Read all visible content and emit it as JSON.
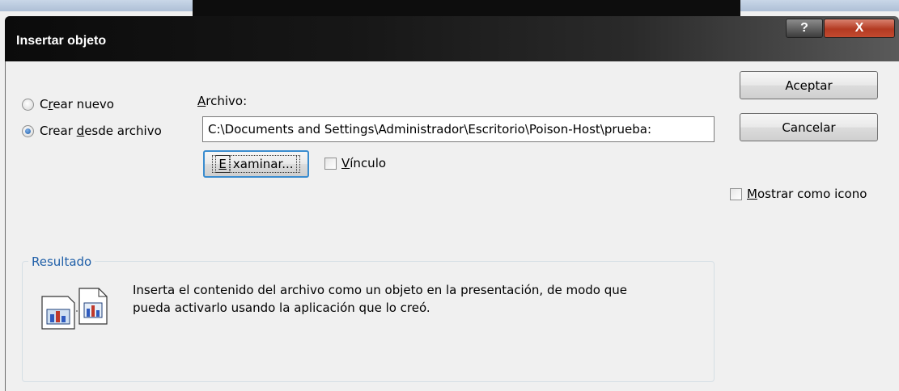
{
  "dialog": {
    "title": "Insertar objeto",
    "help_symbol": "?",
    "close_symbol": "X"
  },
  "radios": {
    "crear_nuevo": {
      "prefix": "C",
      "accel": "r",
      "suffix": "ear nuevo",
      "selected": false
    },
    "crear_desde_archivo": {
      "prefix": "Crear ",
      "accel": "d",
      "suffix": "esde archivo",
      "selected": true
    }
  },
  "archivo": {
    "label_accel": "A",
    "label_rest": "rchivo:",
    "value": "C:\\Documents and Settings\\Administrador\\Escritorio\\Poison-Host\\prueba:"
  },
  "buttons": {
    "examinar_accel": "E",
    "examinar_rest": "xaminar...",
    "aceptar": "Aceptar",
    "cancelar": "Cancelar"
  },
  "checks": {
    "vinculo": {
      "accel": "V",
      "rest": "ínculo",
      "checked": false
    },
    "mostrar_icono": {
      "accel": "M",
      "rest": "ostrar como icono",
      "checked": false
    }
  },
  "resultado": {
    "legend": "Resultado",
    "line1": "Inserta el contenido del archivo como un objeto en la presentación, de modo que",
    "line2": "pueda activarlo usando la aplicación que lo creó.",
    "icon": "embedded-object-icon"
  }
}
